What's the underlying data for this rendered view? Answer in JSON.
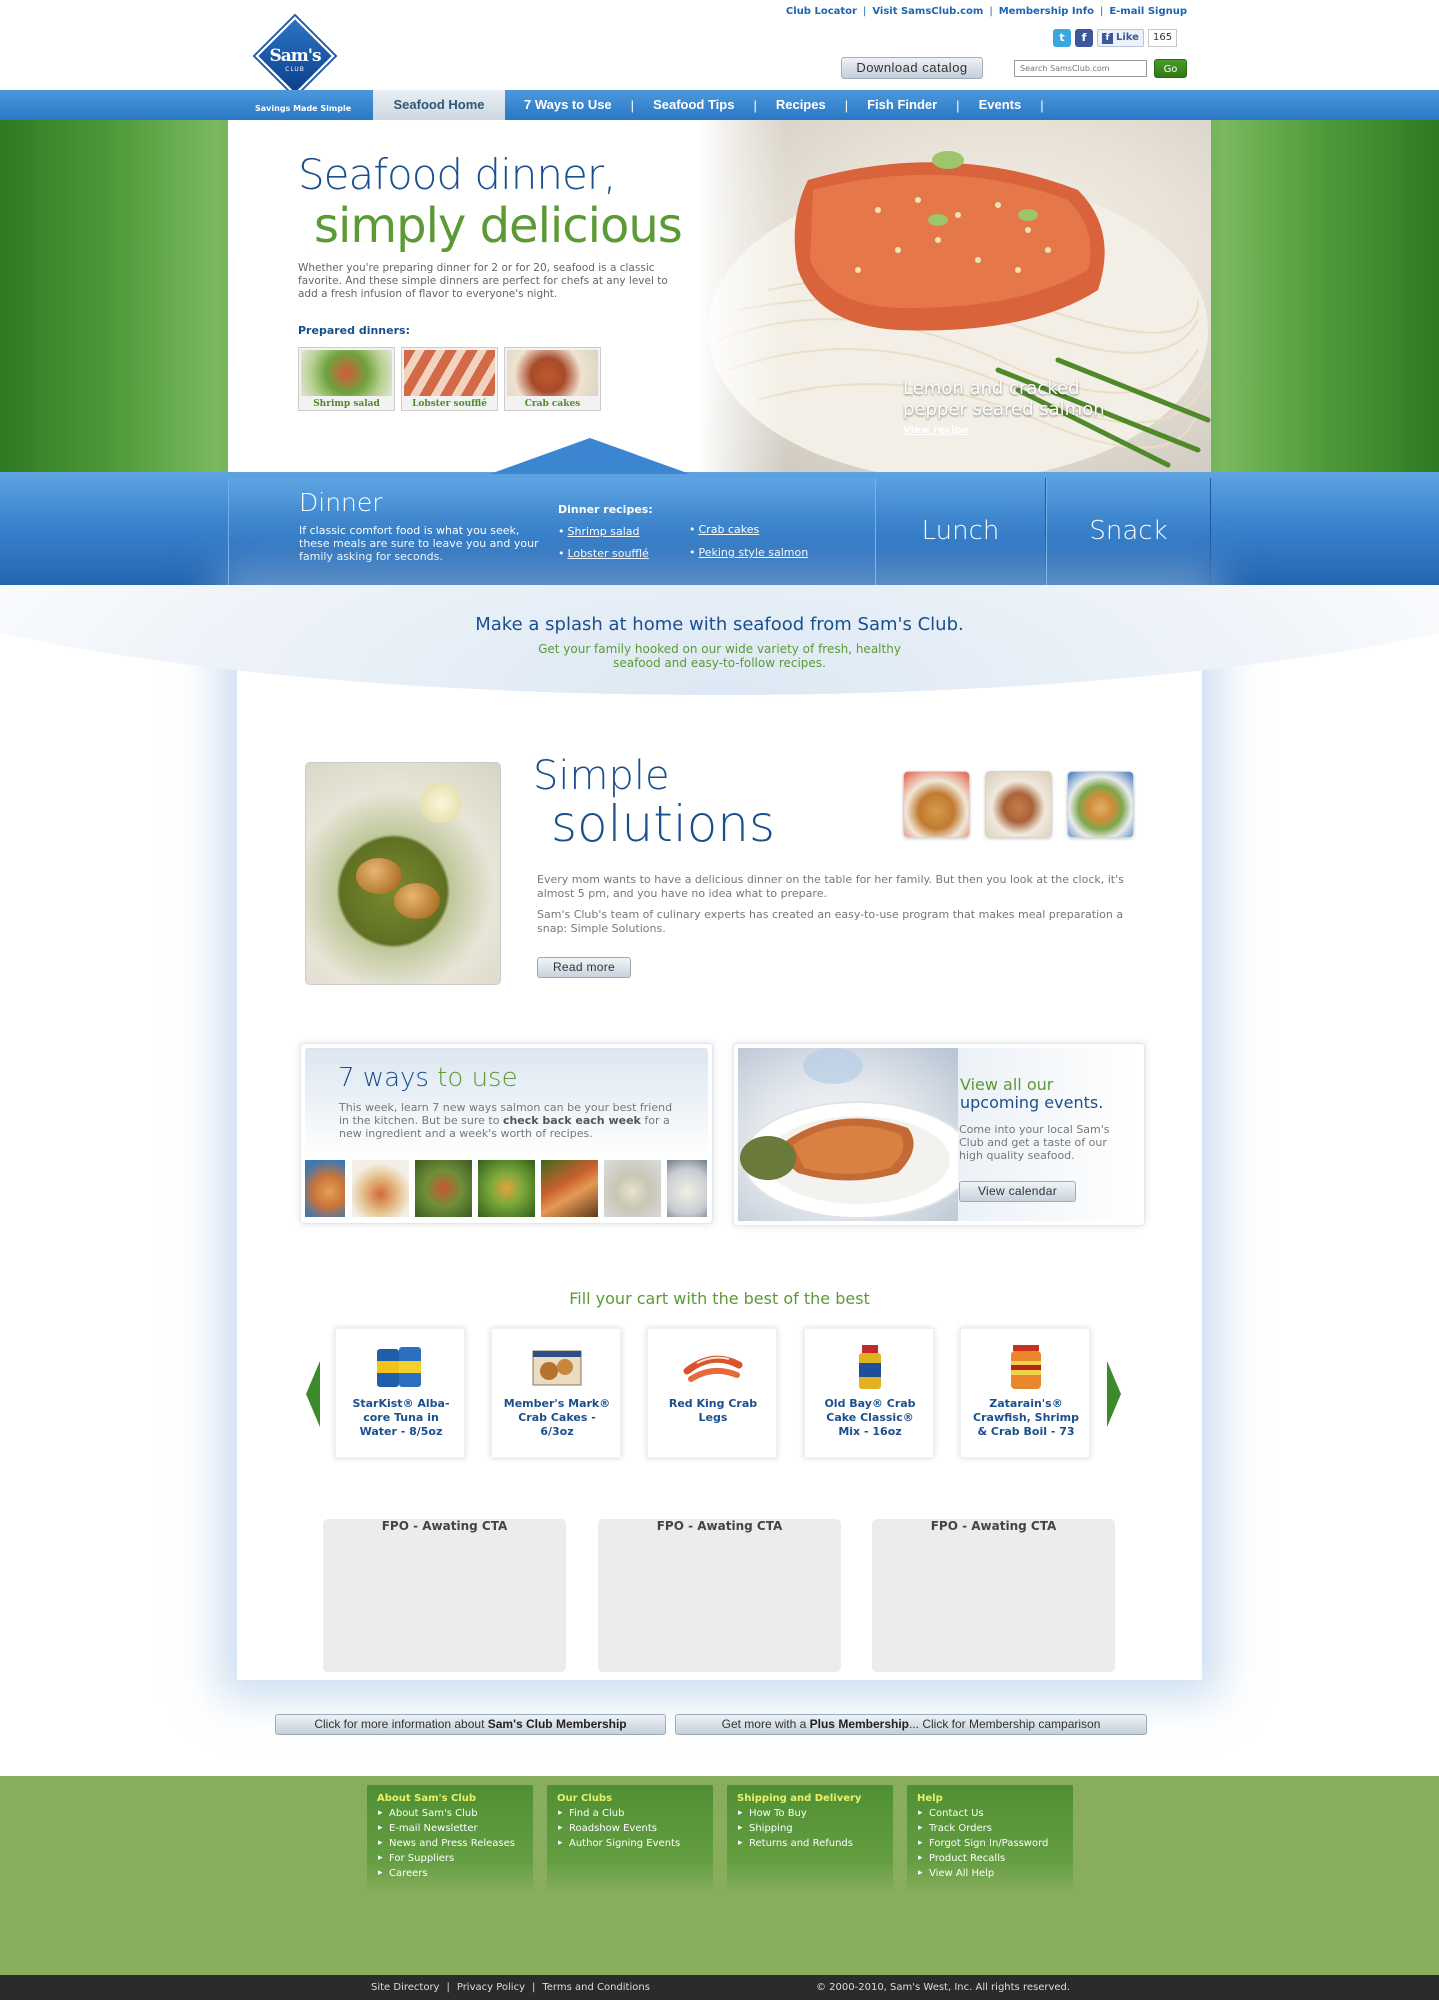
{
  "header": {
    "logo_text": "Sam's",
    "logo_sub": "CLUB",
    "tagline": "Savings Made Simple",
    "top_links": [
      "Club Locator",
      "Visit SamsClub.com",
      "Membership Info",
      "E-mail Signup"
    ],
    "like_label": "Like",
    "like_count": "165",
    "download_catalog": "Download catalog",
    "search_placeholder": "Search SamsClub.com",
    "go_label": "Go"
  },
  "nav": {
    "items": [
      "Seafood Home",
      "7 Ways to Use",
      "Seafood Tips",
      "Recipes",
      "Fish Finder",
      "Events"
    ],
    "active": "Seafood Home"
  },
  "hero": {
    "title_line1": "Seafood dinner,",
    "title_line2": "simply delicious",
    "description": "Whether you're preparing dinner for 2 or for 20, seafood is a classic favorite. And these simple dinners are perfect for chefs at any level to add a fresh infusion of flavor to everyone's night.",
    "prepared_heading": "Prepared dinners:",
    "prepared": [
      "Shrimp salad",
      "Lobster soufflé",
      "Crab cakes"
    ],
    "caption_line1": "Lemon and cracked",
    "caption_line2": "pepper seared salmon",
    "view_recipe": "View recipe"
  },
  "meals": {
    "dinner_title": "Dinner",
    "dinner_desc": "If classic comfort food is what you seek, these meals are sure to leave you and your family asking for seconds.",
    "recipes_heading": "Dinner recipes:",
    "recipes": [
      "Shrimp salad",
      "Lobster soufflé",
      "Crab cakes",
      "Peking style salmon"
    ],
    "tabs": [
      "Lunch",
      "Snack"
    ]
  },
  "splash": {
    "title": "Make a splash at home with seafood from Sam's Club.",
    "subtitle_line1": "Get your family hooked on our wide variety of fresh, healthy",
    "subtitle_line2": "seafood and easy-to-follow recipes."
  },
  "simple_solutions": {
    "title_line1": "Simple",
    "title_line2": "solutions",
    "p1": "Every mom wants to have a delicious dinner on the table for her family. But then you look at the clock, it's almost 5 pm, and you have no idea what to prepare.",
    "p2": "Sam's Club's team of culinary experts has created an easy-to-use program that makes meal preparation a snap: Simple Solutions.",
    "read_more": "Read more"
  },
  "ways": {
    "title_a": "7 ways ",
    "title_b": "to use",
    "desc_a": "This week, learn 7 new ways salmon can be your best friend in the kitchen. But be sure to ",
    "desc_bold": "check back each week",
    "desc_c": " for a new ingredient and a week's worth of recipes."
  },
  "events": {
    "title_line1": "View all our",
    "title_line2": "upcoming events.",
    "desc": "Come into your local Sam's Club and get a taste of our high quality seafood.",
    "button": "View calendar"
  },
  "products": {
    "heading": "Fill your cart with the best of the best",
    "items": [
      {
        "name": "StarKist® Alba-core Tuna in Water - 8/5oz"
      },
      {
        "name": "Member's Mark® Crab Cakes - 6/3oz"
      },
      {
        "name": "Red King Crab Legs"
      },
      {
        "name": "Old Bay® Crab Cake Classic® Mix - 16oz"
      },
      {
        "name": "Zatarain's® Crawfish, Shrimp & Crab Boil - 73"
      }
    ]
  },
  "cta": [
    "FPO - Awating CTA",
    "FPO - Awating CTA",
    "FPO - Awating CTA"
  ],
  "membership": {
    "btn1_a": "Click for more information about ",
    "btn1_b": "Sam's Club Membership",
    "btn2_a": "Get more with a ",
    "btn2_b": "Plus Membership",
    "btn2_c": "... Click for Membership camparison"
  },
  "footer": {
    "columns": [
      {
        "heading": "About Sam's Club",
        "links": [
          "About Sam's Club",
          "E-mail Newsletter",
          "News and Press Releases",
          "For Suppliers",
          "Careers"
        ]
      },
      {
        "heading": "Our Clubs",
        "links": [
          "Find a Club",
          "Roadshow Events",
          "Author Signing Events"
        ]
      },
      {
        "heading": "Shipping and Delivery",
        "links": [
          "How To Buy",
          "Shipping",
          "Returns and Refunds"
        ]
      },
      {
        "heading": "Help",
        "links": [
          "Contact Us",
          "Track Orders",
          "Forgot Sign In/Password",
          "Product Recalls",
          "View All Help"
        ]
      }
    ],
    "bottom_links": [
      "Site Directory",
      "Privacy Policy",
      "Terms and Conditions"
    ],
    "copyright": "© 2000-2010, Sam's West, Inc. All rights reserved."
  }
}
